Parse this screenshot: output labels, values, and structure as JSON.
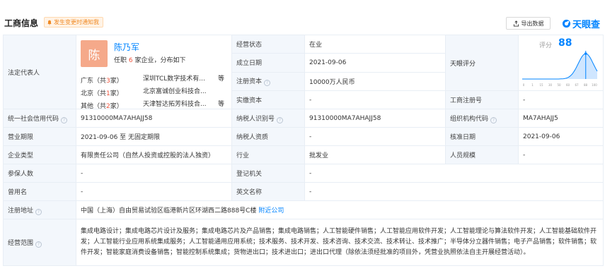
{
  "header": {
    "title": "工商信息",
    "notice": "发生变更时通知我",
    "export_label": "导出数据",
    "logo_text": "天眼查"
  },
  "legal_rep": {
    "label": "法定代表人",
    "avatar_char": "陈",
    "name": "陈乃军",
    "desc_prefix": "任职",
    "desc_count": "6",
    "desc_suffix": "家企业，分布如下",
    "regions": [
      {
        "region": "广东",
        "count": "3",
        "company": "深圳TCL数字技术有...",
        "more": "等"
      },
      {
        "region": "北京",
        "count": "1",
        "company": "北京富诚创业科技合...",
        "more": ""
      },
      {
        "region": "其他",
        "count": "2",
        "company": "天津智达拓芳科技合...",
        "more": "等"
      }
    ]
  },
  "rows": {
    "status_label": "经营状态",
    "status_value": "在业",
    "found_label": "成立日期",
    "found_value": "2021-09-06",
    "reg_cap_label": "注册资本",
    "reg_cap_value": "10000万人民币",
    "paid_cap_label": "实缴资本",
    "paid_cap_value": "-",
    "rating_label": "天眼评分",
    "score_label": "评分",
    "score_value": "88",
    "reg_no_label": "工商注册号",
    "reg_no_value": "-",
    "credit_label": "统一社会信用代码",
    "credit_value": "91310000MA7AHAJJ58",
    "tax_label": "纳税人识别号",
    "tax_value": "91310000MA7AHAJJ58",
    "org_label": "组织机构代码",
    "org_value": "MA7AHAJJ5",
    "term_label": "营业期限",
    "term_value": "2021-09-06 至 无固定期限",
    "taxq_label": "纳税人资质",
    "taxq_value": "-",
    "approve_label": "核准日期",
    "approve_value": "2021-09-06",
    "type_label": "企业类型",
    "type_value": "有限责任公司（自然人投资或控股的法人独资）",
    "industry_label": "行业",
    "industry_value": "批发业",
    "staff_label": "人员规模",
    "staff_value": "-",
    "insured_label": "参保人数",
    "insured_value": "-",
    "authority_label": "登记机关",
    "authority_value": "-",
    "former_label": "曾用名",
    "former_value": "-",
    "eng_label": "英文名称",
    "eng_value": "-",
    "addr_label": "注册地址",
    "addr_value": "中国（上海）自由贸易试验区临港新片区环湖西二路888号C楼",
    "addr_link": "附近公司",
    "scope_label": "经营范围",
    "scope_value": "集成电路设计；集成电路芯片设计及服务；集成电路芯片及产品销售；集成电路销售；人工智能硬件销售；人工智能应用软件开发；人工智能理论与算法软件开发；人工智能基础软件开发；人工智能行业应用系统集成服务；人工智能通用应用系统；技术服务、技术开发、技术咨询、技术交流、技术转让、技术推广；半导体分立器件销售；电子产品销售；软件销售；软件开发；智能家庭消费设备销售；智能控制系统集成；货物进出口；技术进出口；进出口代理（除依法须经批准的项目外，凭营业执照依法自主开展经营活动）。"
  },
  "score_curve": {
    "axis_ticks": [
      "0",
      "1",
      "15",
      "30",
      "50",
      "60",
      "67",
      "88",
      "100"
    ],
    "score": 88,
    "colors": {
      "accent": "#0084ff",
      "fill": "#cfe6ff"
    }
  }
}
